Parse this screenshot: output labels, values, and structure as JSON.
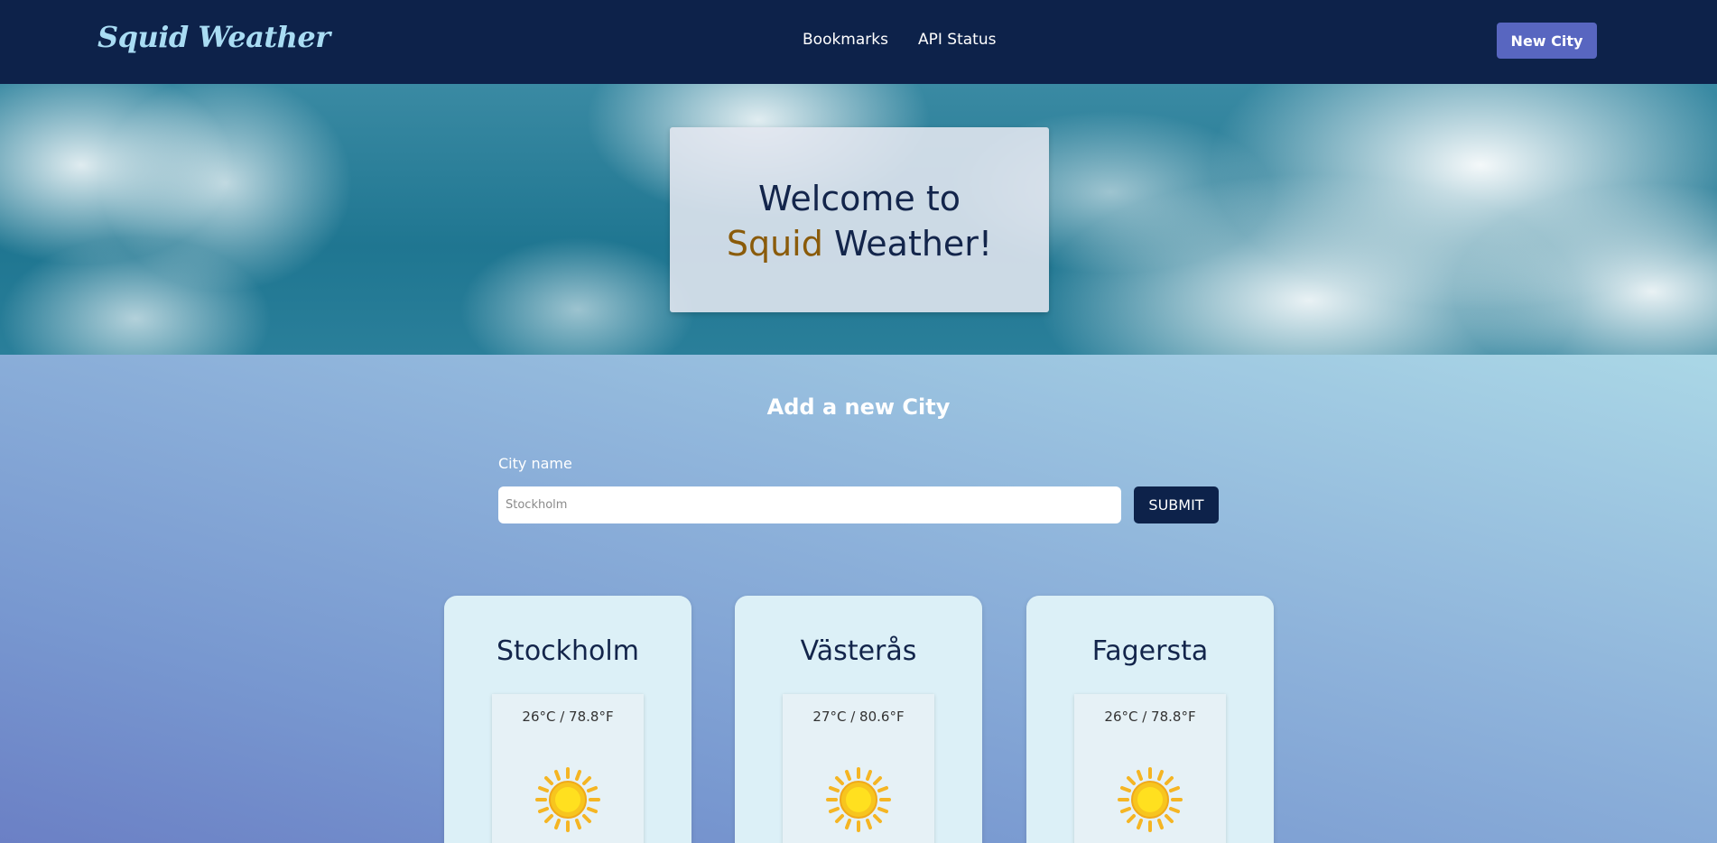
{
  "navbar": {
    "logo": "Squid Weather",
    "links": [
      "Bookmarks",
      "API Status"
    ],
    "new_city_label": "New City"
  },
  "hero": {
    "welcome_line1": "Welcome to",
    "welcome_squid": "Squid",
    "welcome_rest": "Weather!"
  },
  "form": {
    "title": "Add a new City",
    "label": "City name",
    "placeholder": "Stockholm",
    "submit_label": "SUBMIT"
  },
  "cities": [
    {
      "name": "Stockholm",
      "temp": "26°C / 78.8°F",
      "icon": "sun-icon"
    },
    {
      "name": "Västerås",
      "temp": "27°C / 80.6°F",
      "icon": "sun-icon"
    },
    {
      "name": "Fagersta",
      "temp": "26°C / 78.8°F",
      "icon": "sun-icon"
    }
  ],
  "colors": {
    "navbar_bg": "#0d224a",
    "logo": "#a9dcf3",
    "accent_button": "#5866c0",
    "squid_text": "#8a5b0a",
    "sun": "#f7c51e"
  }
}
